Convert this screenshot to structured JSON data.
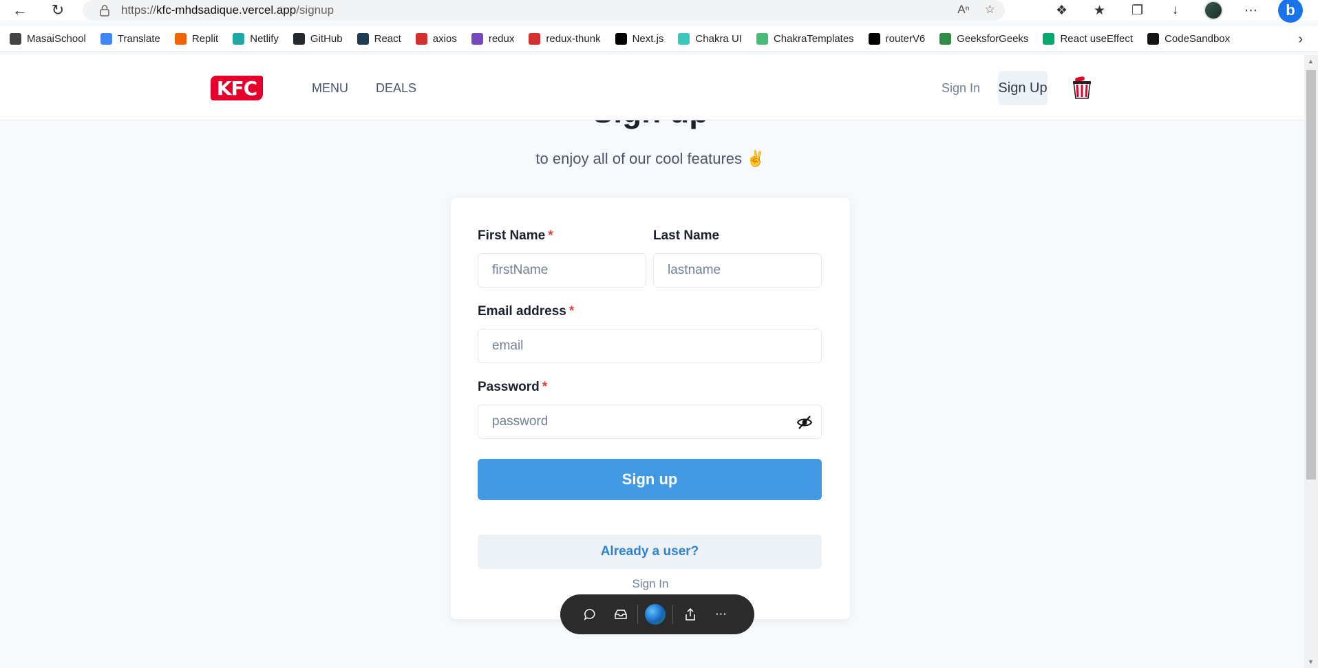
{
  "browser": {
    "url_prefix": "https://",
    "url_host": "kfc-mhdsadique.vercel.app",
    "url_path": "/signup",
    "bookmarks": [
      {
        "label": "MasaiSchool",
        "icon": "document-icon",
        "color": "#444444"
      },
      {
        "label": "Translate",
        "icon": "google-translate-icon",
        "color": "#4285f4"
      },
      {
        "label": "Replit",
        "icon": "replit-icon",
        "color": "#f26207"
      },
      {
        "label": "Netlify",
        "icon": "netlify-icon",
        "color": "#20a9a3"
      },
      {
        "label": "GitHub",
        "icon": "github-icon",
        "color": "#24292e"
      },
      {
        "label": "React",
        "icon": "react-icon",
        "color": "#1d3b53"
      },
      {
        "label": "axios",
        "icon": "axios-icon",
        "color": "#d32f2f"
      },
      {
        "label": "redux",
        "icon": "redux-icon",
        "color": "#764abc"
      },
      {
        "label": "redux-thunk",
        "icon": "redux-thunk-icon",
        "color": "#d32f2f"
      },
      {
        "label": "Next.js",
        "icon": "nextjs-icon",
        "color": "#000000"
      },
      {
        "label": "Chakra UI",
        "icon": "chakra-icon",
        "color": "#3cc7bd"
      },
      {
        "label": "ChakraTemplates",
        "icon": "chakra-templates-icon",
        "color": "#48bb78"
      },
      {
        "label": "routerV6",
        "icon": "dev-icon",
        "color": "#000000"
      },
      {
        "label": "GeeksforGeeks",
        "icon": "gfg-icon",
        "color": "#2f8d46"
      },
      {
        "label": "React useEffect",
        "icon": "w3schools-icon",
        "color": "#04aa6d"
      },
      {
        "label": "CodeSandbox",
        "icon": "codesandbox-icon",
        "color": "#151515"
      }
    ]
  },
  "header": {
    "logo_text": "KFC",
    "nav": [
      "MENU",
      "DEALS"
    ],
    "sign_in": "Sign In",
    "sign_up": "Sign Up"
  },
  "page": {
    "title": "Sign up",
    "subtitle": "to enjoy all of our cool features ✌️"
  },
  "form": {
    "first_name_label": "First Name",
    "first_name_placeholder": "firstName",
    "last_name_label": "Last Name",
    "last_name_placeholder": "lastname",
    "email_label": "Email address",
    "email_placeholder": "email",
    "password_label": "Password",
    "password_placeholder": "password",
    "required_mark": "*",
    "submit": "Sign up",
    "already_user": "Already a user?",
    "sign_in": "Sign In"
  },
  "colors": {
    "primary": "#4299e1",
    "brand_red": "#e4002b",
    "required": "#e53e3e"
  }
}
